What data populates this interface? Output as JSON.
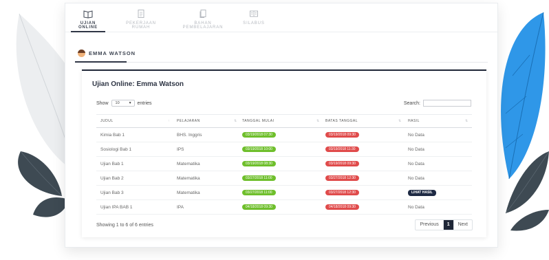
{
  "tabs": [
    {
      "label": "Ujian Online",
      "icon": "book-icon",
      "active": true
    },
    {
      "label": "Pekerjaan Rumah",
      "icon": "document-icon",
      "active": false
    },
    {
      "label": "Bahan Pembelajaran",
      "icon": "files-icon",
      "active": false
    },
    {
      "label": "Silabus",
      "icon": "open-book-icon",
      "active": false
    }
  ],
  "user_tab": {
    "name": "EMMA WATSON",
    "icon": "avatar-icon"
  },
  "card": {
    "title": "Ujian Online: Emma Watson",
    "show_label": "Show",
    "entries_value": "10",
    "entries_label": "entries",
    "search_label": "Search:",
    "search_value": ""
  },
  "table": {
    "headers": [
      "JUDUL",
      "PELAJARAN",
      "TANGGAL MULAI",
      "BATAS TANGGAL",
      "HASIL"
    ],
    "rows": [
      {
        "judul": "Kimia Bab 1",
        "pelajaran": "BHS. Inggris",
        "mulai": "03/19/2018 07:30",
        "batas": "03/19/2018 09:30",
        "hasil": "No Data"
      },
      {
        "judul": "Sosiologi Bab 1",
        "pelajaran": "IPS",
        "mulai": "03/19/2018 10:00",
        "batas": "03/19/2018 11:30",
        "hasil": "No Data"
      },
      {
        "judul": "Ujian Bab 1",
        "pelajaran": "Matematika",
        "mulai": "03/19/2018 08:30",
        "batas": "03/19/2018 09:30",
        "hasil": "No Data"
      },
      {
        "judul": "Ujian Bab 2",
        "pelajaran": "Matematika",
        "mulai": "03/27/2018 11:00",
        "batas": "03/27/2018 12:30",
        "hasil": "No Data"
      },
      {
        "judul": "Ujian Bab 3",
        "pelajaran": "Matematika",
        "mulai": "03/27/2018 11:00",
        "batas": "03/27/2018 12:30",
        "hasil": "LIHAT HASIL"
      },
      {
        "judul": "Ujian IPA BAB 1",
        "pelajaran": "IPA",
        "mulai": "04/18/2018 09:30",
        "batas": "04/18/2018 09:30",
        "hasil": "No Data"
      }
    ]
  },
  "footer": {
    "info": "Showing 1 to 6 of 6 entries",
    "previous": "Previous",
    "page": "1",
    "next": "Next"
  },
  "colors": {
    "accent": "#1f2737",
    "start_pill": "#6fbf2c",
    "end_pill": "#e04b4b",
    "leaf_blue": "#2f97e8",
    "leaf_dark": "#3e4a53"
  }
}
